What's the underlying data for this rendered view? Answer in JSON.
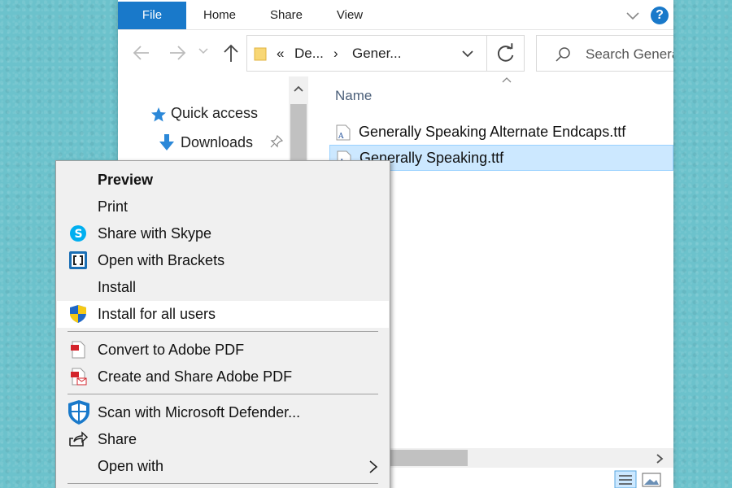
{
  "ribbon": {
    "tabs": [
      "File",
      "Home",
      "Share",
      "View"
    ],
    "help_label": "?"
  },
  "navigation": {
    "back_icon": "arrow-left-icon",
    "forward_icon": "arrow-right-icon",
    "recent_icon": "chevron-down-icon",
    "up_icon": "arrow-up-icon"
  },
  "address": {
    "overflow": "«",
    "crumbs": [
      "De...",
      "Gener..."
    ],
    "separator": "›"
  },
  "search": {
    "placeholder": "Search Genera"
  },
  "nav_pane": {
    "items": [
      {
        "label": "Quick access",
        "icon": "star-icon"
      },
      {
        "label": "Downloads",
        "icon": "download-arrow-icon",
        "pinned": true
      }
    ]
  },
  "file_list": {
    "column_name": "Name",
    "files": [
      {
        "name": "Generally Speaking Alternate Endcaps.ttf",
        "selected": false
      },
      {
        "name": "Generally Speaking.ttf",
        "selected": true
      }
    ]
  },
  "context_menu": {
    "groups": [
      [
        {
          "label": "Preview",
          "bold": true,
          "icon": ""
        },
        {
          "label": "Print",
          "icon": ""
        },
        {
          "label": "Share with Skype",
          "icon": "skype-icon"
        },
        {
          "label": "Open with Brackets",
          "icon": "brackets-icon"
        },
        {
          "label": "Install",
          "icon": ""
        },
        {
          "label": "Install for all users",
          "icon": "uac-shield-icon",
          "hover": true
        }
      ],
      [
        {
          "label": "Convert to Adobe PDF",
          "icon": "adobe-pdf-icon"
        },
        {
          "label": "Create and Share Adobe PDF",
          "icon": "adobe-pdf-share-icon"
        }
      ],
      [
        {
          "label": "Scan with Microsoft Defender...",
          "icon": "defender-shield-icon"
        },
        {
          "label": "Share",
          "icon": "share-icon"
        },
        {
          "label": "Open with",
          "icon": "",
          "submenu": true
        }
      ]
    ]
  },
  "colors": {
    "accent": "#1979ca",
    "selection": "#cce8ff",
    "background": "#6cc2cc"
  }
}
